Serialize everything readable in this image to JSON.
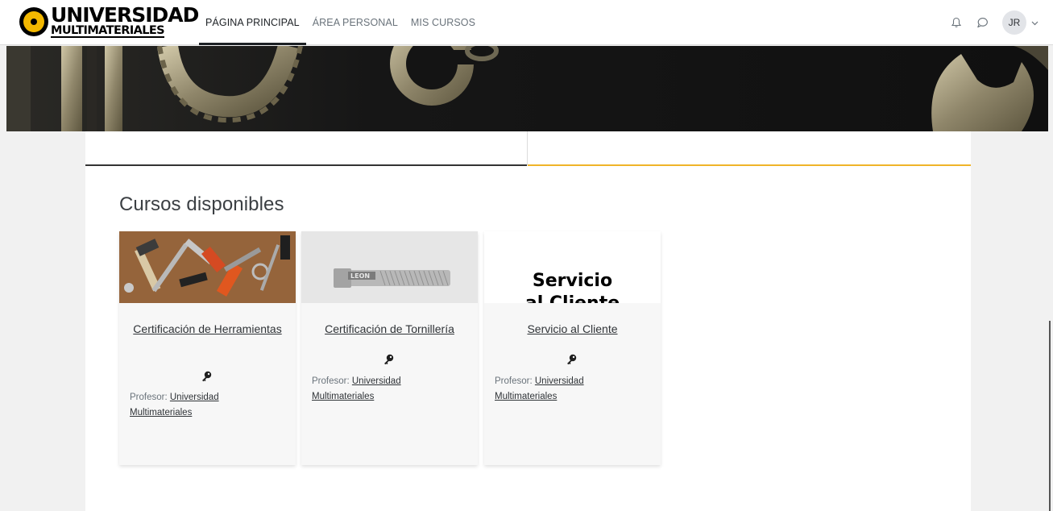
{
  "app": {
    "logo_line1": "UNIVERSIDAD",
    "logo_line2": "MULTIMATERIALES"
  },
  "nav": {
    "items": [
      {
        "label": "PÁGINA PRINCIPAL",
        "active": true
      },
      {
        "label": "ÁREA PERSONAL",
        "active": false
      },
      {
        "label": "MIS CURSOS",
        "active": false
      }
    ],
    "user_initials": "JR",
    "icons": [
      "bell-icon",
      "chat-bubble-icon",
      "chevron-down-icon"
    ]
  },
  "main": {
    "section_title": "Cursos disponibles",
    "courses": [
      {
        "title": "Certificación de Herramientas",
        "teacher_label": "Profesor:",
        "teacher_name": "Universidad Multimateriales"
      },
      {
        "title": "Certificación de Tornillería",
        "teacher_label": "Profesor:",
        "teacher_name": "Universidad Multimateriales",
        "image_text": "LEON"
      },
      {
        "title": "Servicio al Cliente",
        "teacher_label": "Profesor:",
        "teacher_name": "Universidad Multimateriales",
        "image_text_line1": "Servicio",
        "image_text_line2": "al Cliente"
      }
    ]
  },
  "colors": {
    "accent": "#f0b429",
    "nav_active": "#1d2125",
    "logo_yellow": "#f3b800"
  }
}
